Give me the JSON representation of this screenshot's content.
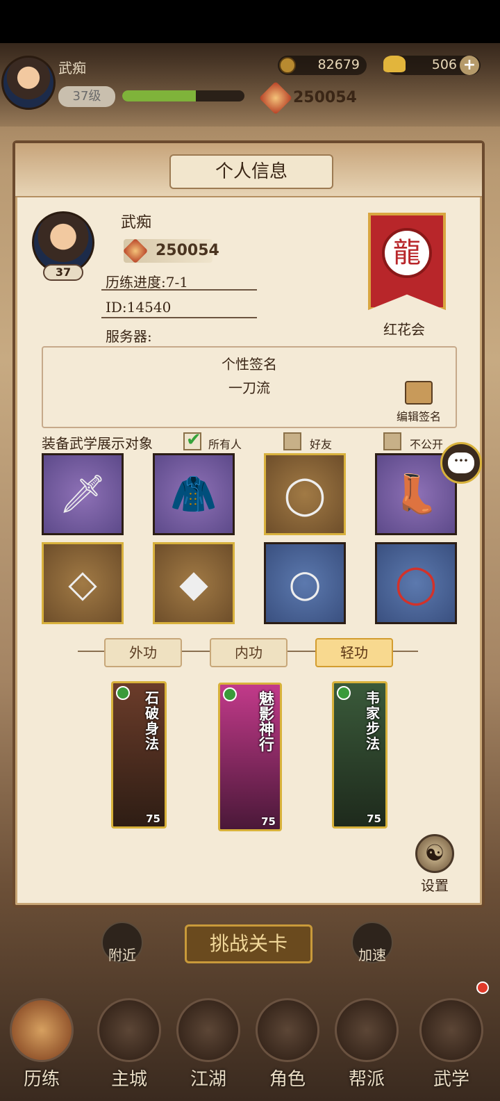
{
  "header": {
    "player_name": "武痴",
    "level": "37级",
    "level_progress": 0.6,
    "power": "250054",
    "coins": "82679",
    "ingots": "506"
  },
  "panel": {
    "title": "个人信息",
    "name": "武痴",
    "power": "250054",
    "avatar_level": "37",
    "progress": "历练进度:7-1",
    "id": "ID:14540",
    "server": "服务器:",
    "guild_name": "红花会",
    "signature_title": "个性签名",
    "signature_text": "一刀流",
    "edit_signature": "编辑签名",
    "display_label": "装备武学展示对象",
    "display_options": [
      {
        "label": "所有人",
        "checked": true
      },
      {
        "label": "好友",
        "checked": false
      },
      {
        "label": "不公开",
        "checked": false
      }
    ],
    "equipment": [
      {
        "icon": "saber-icon",
        "rarity": "purple"
      },
      {
        "icon": "cape-icon",
        "rarity": "purple"
      },
      {
        "icon": "belt-icon",
        "rarity": "gold"
      },
      {
        "icon": "boots-icon",
        "rarity": "purple"
      },
      {
        "icon": "necklace-icon",
        "rarity": "gold"
      },
      {
        "icon": "hairpin-icon",
        "rarity": "gold"
      },
      {
        "icon": "ring-icon",
        "rarity": "blue"
      },
      {
        "icon": "bracelet-icon",
        "rarity": "blue"
      }
    ],
    "tabs": [
      "外功",
      "内功",
      "轻功"
    ],
    "selected_tab": "轻功",
    "skills": [
      {
        "name": "石破身法",
        "level": "75"
      },
      {
        "name": "魅影神行",
        "level": "75"
      },
      {
        "name": "韦家步法",
        "level": "75"
      }
    ],
    "settings_label": "设置"
  },
  "scene": {
    "nearby": "附近",
    "challenge": "挑战关卡",
    "speedup": "加速"
  },
  "bottom_nav": [
    "历练",
    "主城",
    "江湖",
    "角色",
    "帮派",
    "武学"
  ],
  "colors": {
    "accent_gold": "#d8b23b",
    "banner_red": "#b8262a"
  }
}
